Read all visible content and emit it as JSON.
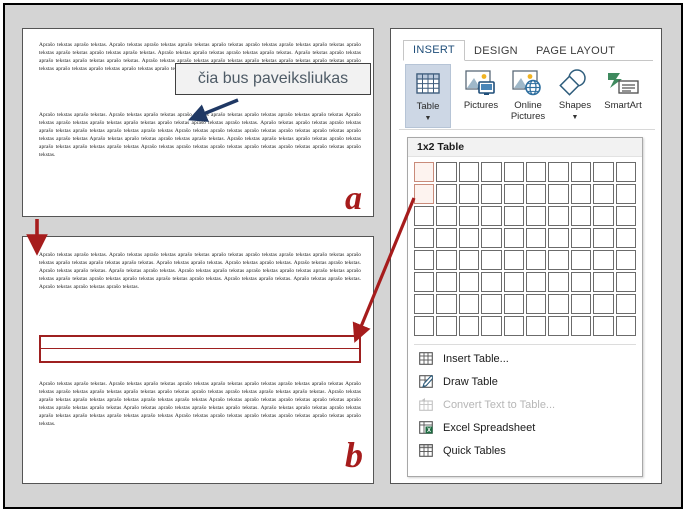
{
  "document_left": {
    "page_a": {
      "paragraph_1": "Aprašo tekstas aprašo tekstas. Aprašo tekstas aprašo tekstas aprašo tekstas aprašo tekstas aprašo tekstas aprašo tekstas aprašo tekstas aprašo tekstas aprašo tekstas aprašo tekstas aprašo tekstas. Aprašo tekstas aprašo tekstas aprašo tekstas aprašo tekstas. Aprašo tekstas aprašo tekstas aprašo tekstas aprašo tekstas aprašo tekstas. Aprašo tekstas aprašo tekstas aprašo tekstas aprašo tekstas aprašo tekstas aprašo tekstas aprašo tekstas aprašo tekstas aprašo tekstas aprašo tekstas aprašo tekstas. Aprašo tekstas aprašo tekstas.",
      "paragraph_2": "Aprašo tekstas aprašo tekstas. Aprašo tekstas aprašo tekstas aprašo tekstas aprašo tekstas aprašo tekstas aprašo tekstas aprašo tekstas Aprašo tekstas aprašo tekstas aprašo tekstas aprašo tekstas aprašo tekstas aprašo tekstas aprašo tekstas. Aprašo tekstas aprašo tekstas aprašo tekstas aprašo tekstas aprašo tekstas aprašo tekstas aprašo tekstas Aprašo tekstas aprašo tekstas aprašo tekstas aprašo tekstas aprašo tekstas aprašo tekstas aprašo tekstas Aprašo tekstas aprašo tekstas aprašo tekstas aprašo tekstas. Aprašo tekstas aprašo tekstas aprašo tekstas aprašo tekstas aprašo tekstas aprašo tekstas aprašo tekstas Aprašo tekstas aprašo tekstas aprašo tekstas aprašo tekstas aprašo tekstas aprašo tekstas aprašo tekstas.",
      "label": "a"
    },
    "page_b": {
      "paragraph_1": "Aprašo tekstas aprašo tekstas. Aprašo tekstas aprašo tekstas aprašo tekstas aprašo tekstas aprašo tekstas aprašo tekstas aprašo tekstas aprašo tekstas aprašo tekstas aprašo tekstas aprašo tekstas. Aprašo tekstas aprašo tekstas. Aprašo tekstas aprašo tekstas. Aprašo tekstas aprašo tekstas. Aprašo tekstas aprašo tekstas. Aprašo tekstas aprašo tekstas. Aprašo tekstas aprašo tekstas aprašo tekstas aprašo tekstas aprašo tekstas aprašo tekstas aprašo tekstas aprašo tekstas aprašo tekstas aprašo tekstas aprašo tekstas. Aprašo tekstas aprašo tekstas. Aprašo tekstas aprašo tekstas. Aprašo tekstas aprašo tekstas aprašo tekstas.",
      "paragraph_2": "Aprašo tekstas aprašo tekstas. Aprašo tekstas aprašo tekstas aprašo tekstas aprašo tekstas aprašo tekstas aprašo tekstas aprašo tekstas Aprašo tekstas aprašo tekstas aprašo tekstas aprašo tekstas aprašo tekstas aprašo tekstas aprašo tekstas aprašo tekstas aprašo tekstas. Aprašo tekstas aprašo tekstas aprašo tekstas aprašo tekstas aprašo tekstas aprašo tekstas Aprašo tekstas aprašo tekstas aprašo tekstas aprašo tekstas aprašo tekstas aprašo tekstas aprašo tekstas Aprašo tekstas aprašo tekstas aprašo tekstas aprašo tekstas. Aprašo tekstas aprašo tekstas aprašo tekstas aprašo tekstas aprašo tekstas aprašo tekstas aprašo tekstas Aprašo tekstas aprašo tekstas aprašo tekstas aprašo tekstas aprašo tekstas aprašo tekstas.",
      "label": "b",
      "inserted_table": {
        "rows": 2,
        "columns": 1,
        "border_color": "#9e2020"
      }
    },
    "callout": {
      "text": "čia bus paveiksliukas",
      "text_color": "#4e5b66"
    }
  },
  "ribbon": {
    "tabs": [
      {
        "label": "INSERT",
        "active": true
      },
      {
        "label": "DESIGN",
        "active": false
      },
      {
        "label": "PAGE LAYOUT",
        "active": false
      }
    ],
    "groups": [
      {
        "label": "Table",
        "icon": "table-icon",
        "has_split_caret": true,
        "active": true
      },
      {
        "label": "Pictures",
        "icon": "pictures-icon",
        "has_split_caret": false,
        "active": false
      },
      {
        "label": "Online",
        "label2": "Pictures",
        "icon": "online-pictures-icon",
        "has_split_caret": false,
        "active": false
      },
      {
        "label": "Shapes",
        "icon": "shapes-icon",
        "has_split_caret": true,
        "active": false
      },
      {
        "label": "SmartArt",
        "icon": "smartart-icon",
        "has_split_caret": false,
        "active": false
      }
    ]
  },
  "table_dropdown": {
    "header": "1x2 Table",
    "grid": {
      "columns": 10,
      "rows": 8,
      "selected_columns": 1,
      "selected_rows": 2
    },
    "menu_items": [
      {
        "label": "Insert Table...",
        "icon": "table-grid-icon",
        "disabled": false
      },
      {
        "label": "Draw Table",
        "icon": "pencil-table-icon",
        "disabled": false
      },
      {
        "label": "Convert Text to Table...",
        "icon": "convert-text-icon",
        "disabled": true
      },
      {
        "label": "Excel Spreadsheet",
        "icon": "excel-icon",
        "disabled": false
      },
      {
        "label": "Quick Tables",
        "icon": "quick-tables-icon",
        "disabled": false
      }
    ]
  },
  "annotations": {
    "arrow_color_red": "#a61c1c",
    "arrow_color_blue": "#1f3864"
  }
}
